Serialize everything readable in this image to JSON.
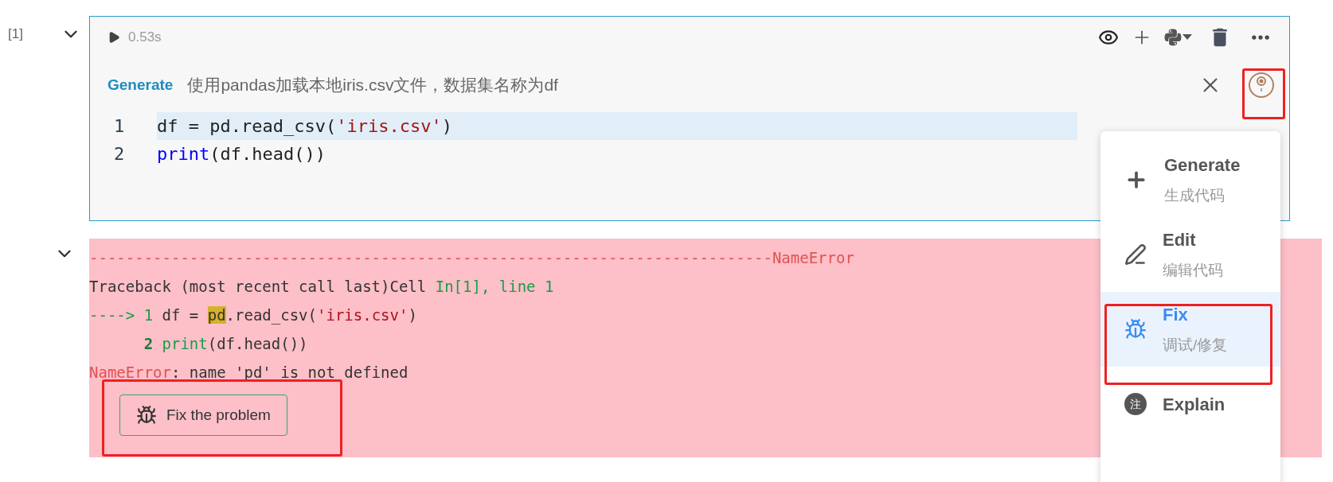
{
  "cell": {
    "execution_count": "[1]",
    "expanded": true,
    "run_time": "0.53s",
    "generate_bar": {
      "label": "Generate",
      "prompt": "使用pandas加载本地iris.csv文件，数据集名称为df"
    },
    "code_lines": [
      {
        "number": "1",
        "highlighted": true,
        "tokens": [
          {
            "text": "df = pd.read_csv(",
            "kind": "plain"
          },
          {
            "text": "'iris.csv'",
            "kind": "string"
          },
          {
            "text": ")",
            "kind": "plain"
          }
        ]
      },
      {
        "number": "2",
        "highlighted": false,
        "tokens": [
          {
            "text": "print",
            "kind": "builtin"
          },
          {
            "text": "(df.head())",
            "kind": "plain"
          }
        ]
      }
    ]
  },
  "output": {
    "expanded": true,
    "lines": [
      [
        {
          "text": "---------------------------------------------------------------------------NameError",
          "kind": "error"
        }
      ],
      [
        {
          "text": "Traceback (most recent call last)Cell ",
          "kind": "plain"
        },
        {
          "text": "In[1], line 1",
          "kind": "green"
        }
      ],
      [
        {
          "text": "----> 1",
          "kind": "green"
        },
        {
          "text": " df = ",
          "kind": "plain"
        },
        {
          "text": "pd",
          "kind": "highlight"
        },
        {
          "text": ".read_csv(",
          "kind": "plain"
        },
        {
          "text": "'iris.csv'",
          "kind": "string"
        },
        {
          "text": ")",
          "kind": "plain"
        }
      ],
      [
        {
          "text": "      2",
          "kind": "green_bold"
        },
        {
          "text": " print",
          "kind": "green"
        },
        {
          "text": "(df.head())",
          "kind": "plain"
        }
      ],
      [
        {
          "text": "NameError",
          "kind": "error"
        },
        {
          "text": ": name 'pd' is not defined",
          "kind": "plain"
        }
      ]
    ],
    "fix_button": "Fix the problem"
  },
  "ai_menu": {
    "items": [
      {
        "kind": "generate",
        "title": "Generate",
        "subtitle": "生成代码",
        "selected": false
      },
      {
        "kind": "edit",
        "title": "Edit",
        "subtitle": "编辑代码",
        "selected": false
      },
      {
        "kind": "fix",
        "title": "Fix",
        "subtitle": "调试/修复",
        "selected": true
      },
      {
        "kind": "explain",
        "title": "Explain",
        "icon_text": "注",
        "selected": false
      }
    ]
  }
}
